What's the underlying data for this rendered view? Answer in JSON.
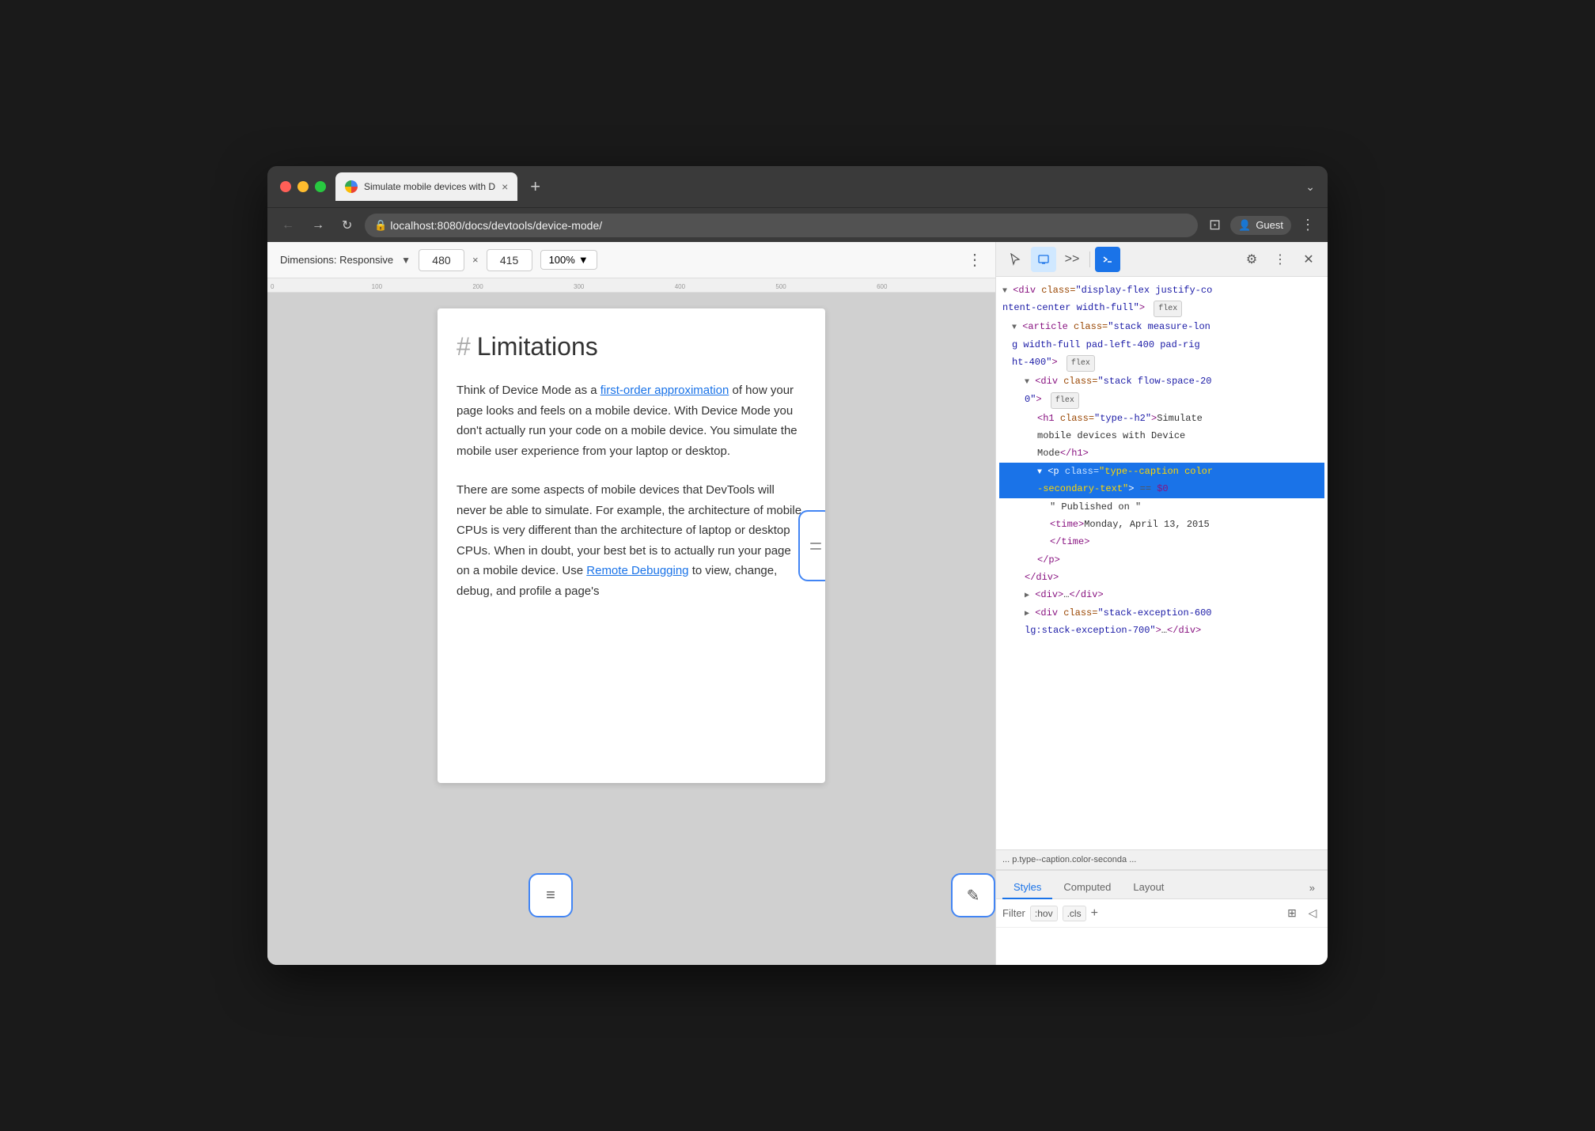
{
  "browser": {
    "tab_title": "Simulate mobile devices with D",
    "tab_close": "×",
    "tab_new": "+",
    "tab_chevron": "⌄",
    "address": "localhost:8080/docs/devtools/device-mode/",
    "guest_label": "Guest",
    "nav_back": "←",
    "nav_forward": "→",
    "nav_reload": "↻"
  },
  "device_toolbar": {
    "dimensions_label": "Dimensions: Responsive",
    "width": "480",
    "height": "415",
    "x_separator": "×",
    "zoom": "100%",
    "more_icon": "⋮"
  },
  "page": {
    "heading_hash": "#",
    "heading": "Limitations",
    "paragraph1": "Think of Device Mode as a ",
    "link1": "first-order approximation",
    "paragraph1b": " of how your page looks and feels on a mobile device. With Device Mode you don't actually run your code on a mobile device. You simulate the mobile user experience from your laptop or desktop.",
    "paragraph2": "There are some aspects of mobile devices that DevTools will never be able to simulate. For example, the architecture of mobile CPUs is very different than the architecture of laptop or desktop CPUs. When in doubt, your best bet is to actually run your page on a mobile device. Use ",
    "link2": "Remote Debugging",
    "paragraph2b": " to view, change, debug, and profile a page's"
  },
  "devtools": {
    "toolbar_icons": [
      "cursor-icon",
      "device-icon",
      "more-panels-icon",
      "console-icon",
      "settings-icon",
      "more-icon",
      "close-icon"
    ],
    "dom": [
      {
        "indent": 0,
        "content": "<div class=\"display-flex justify-co",
        "suffix": "",
        "badge": "flex",
        "selected": false
      },
      {
        "indent": 0,
        "content": "ntent-center width-full\">",
        "suffix": "",
        "badge": "",
        "selected": false
      },
      {
        "indent": 1,
        "content": "<article class=\"stack measure-lon",
        "suffix": "",
        "badge": "",
        "selected": false
      },
      {
        "indent": 1,
        "content": "g width-full pad-left-400 pad-rig",
        "suffix": "",
        "badge": "",
        "selected": false
      },
      {
        "indent": 1,
        "content": "ht-400\">",
        "suffix": "",
        "badge": "flex",
        "selected": false
      },
      {
        "indent": 2,
        "content": "<div class=\"stack flow-space-20",
        "suffix": "",
        "badge": "",
        "selected": false
      },
      {
        "indent": 2,
        "content": "0\">",
        "suffix": "",
        "badge": "flex",
        "selected": false
      },
      {
        "indent": 3,
        "content": "<h1 class=\"type--h2\">Simulate",
        "suffix": "",
        "badge": "",
        "selected": false
      },
      {
        "indent": 3,
        "content": "mobile devices with Device",
        "suffix": "",
        "badge": "",
        "selected": false
      },
      {
        "indent": 3,
        "content": "Mode</h1>",
        "suffix": "",
        "badge": "",
        "selected": false
      },
      {
        "indent": 3,
        "content": "<p class=\"type--caption color",
        "suffix": "",
        "badge": "",
        "selected": true
      },
      {
        "indent": 3,
        "content": "-secondary-text\">",
        "suffix": "== $0",
        "badge": "",
        "selected": true
      },
      {
        "indent": 4,
        "content": "\" Published on \"",
        "suffix": "",
        "badge": "",
        "selected": false
      },
      {
        "indent": 4,
        "content": "<time>Monday, April 13, 2015",
        "suffix": "",
        "badge": "",
        "selected": false
      },
      {
        "indent": 4,
        "content": "</time>",
        "suffix": "",
        "badge": "",
        "selected": false
      },
      {
        "indent": 3,
        "content": "</p>",
        "suffix": "",
        "badge": "",
        "selected": false
      },
      {
        "indent": 2,
        "content": "</div>",
        "suffix": "",
        "badge": "",
        "selected": false
      },
      {
        "indent": 2,
        "content": "<div>…</div>",
        "suffix": "",
        "badge": "",
        "selected": false
      },
      {
        "indent": 2,
        "content": "<div class=\"stack-exception-600",
        "suffix": "",
        "badge": "",
        "selected": false
      },
      {
        "indent": 2,
        "content": "lg:stack-exception-700\">…</div>",
        "suffix": "",
        "badge": "",
        "selected": false
      }
    ],
    "breadcrumb": "...   p.type--caption.color-seconda   ...",
    "styles_tabs": [
      "Styles",
      "Computed",
      "Layout"
    ],
    "styles_tab_more": "»",
    "filter_label": "Filter",
    "filter_hov": ":hov",
    "filter_cls": ".cls",
    "filter_plus": "+",
    "filter_icon1": "⊞",
    "filter_icon2": "◁"
  }
}
